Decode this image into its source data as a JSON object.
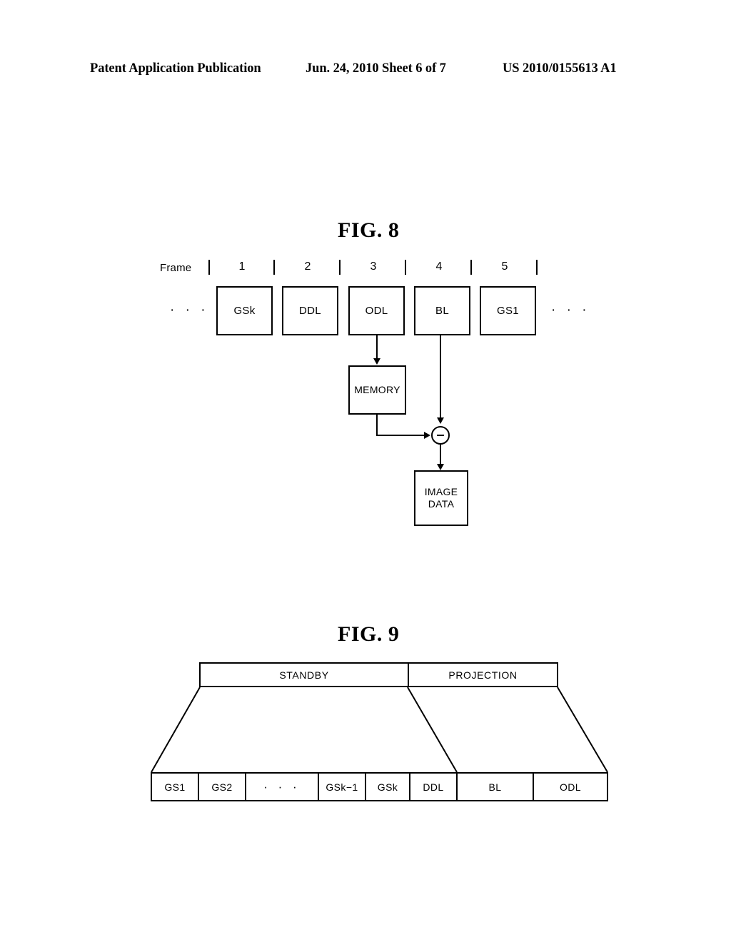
{
  "page": {
    "header": {
      "left": "Patent Application Publication",
      "center": "Jun. 24, 2010  Sheet 6 of 7",
      "right": "US 2010/0155613 A1"
    }
  },
  "figure8": {
    "title": "FIG. 8",
    "frame_axis_label": "Frame",
    "frame_numbers": [
      "1",
      "2",
      "3",
      "4",
      "5"
    ],
    "frame_boxes": [
      {
        "label": "GSk"
      },
      {
        "label": "DDL"
      },
      {
        "label": "ODL"
      },
      {
        "label": "BL"
      },
      {
        "label": "GS1"
      }
    ],
    "ellipsis_left": "· · ·",
    "ellipsis_right": "· · ·",
    "memory_box": "MEMORY",
    "subtractor_symbol": "−",
    "image_data_box": {
      "line1": "IMAGE",
      "line2": "DATA"
    }
  },
  "figure9": {
    "title": "FIG. 9",
    "modes": [
      {
        "label": "STANDBY"
      },
      {
        "label": "PROJECTION"
      }
    ],
    "slots": [
      {
        "label": "GS1"
      },
      {
        "label": "GS2"
      },
      {
        "label": "· · ·"
      },
      {
        "label": "GSk−1"
      },
      {
        "label": "GSk"
      },
      {
        "label": "DDL"
      },
      {
        "label": "BL"
      },
      {
        "label": "ODL"
      }
    ]
  },
  "colors": {
    "ink": "#000000",
    "paper": "#ffffff"
  }
}
